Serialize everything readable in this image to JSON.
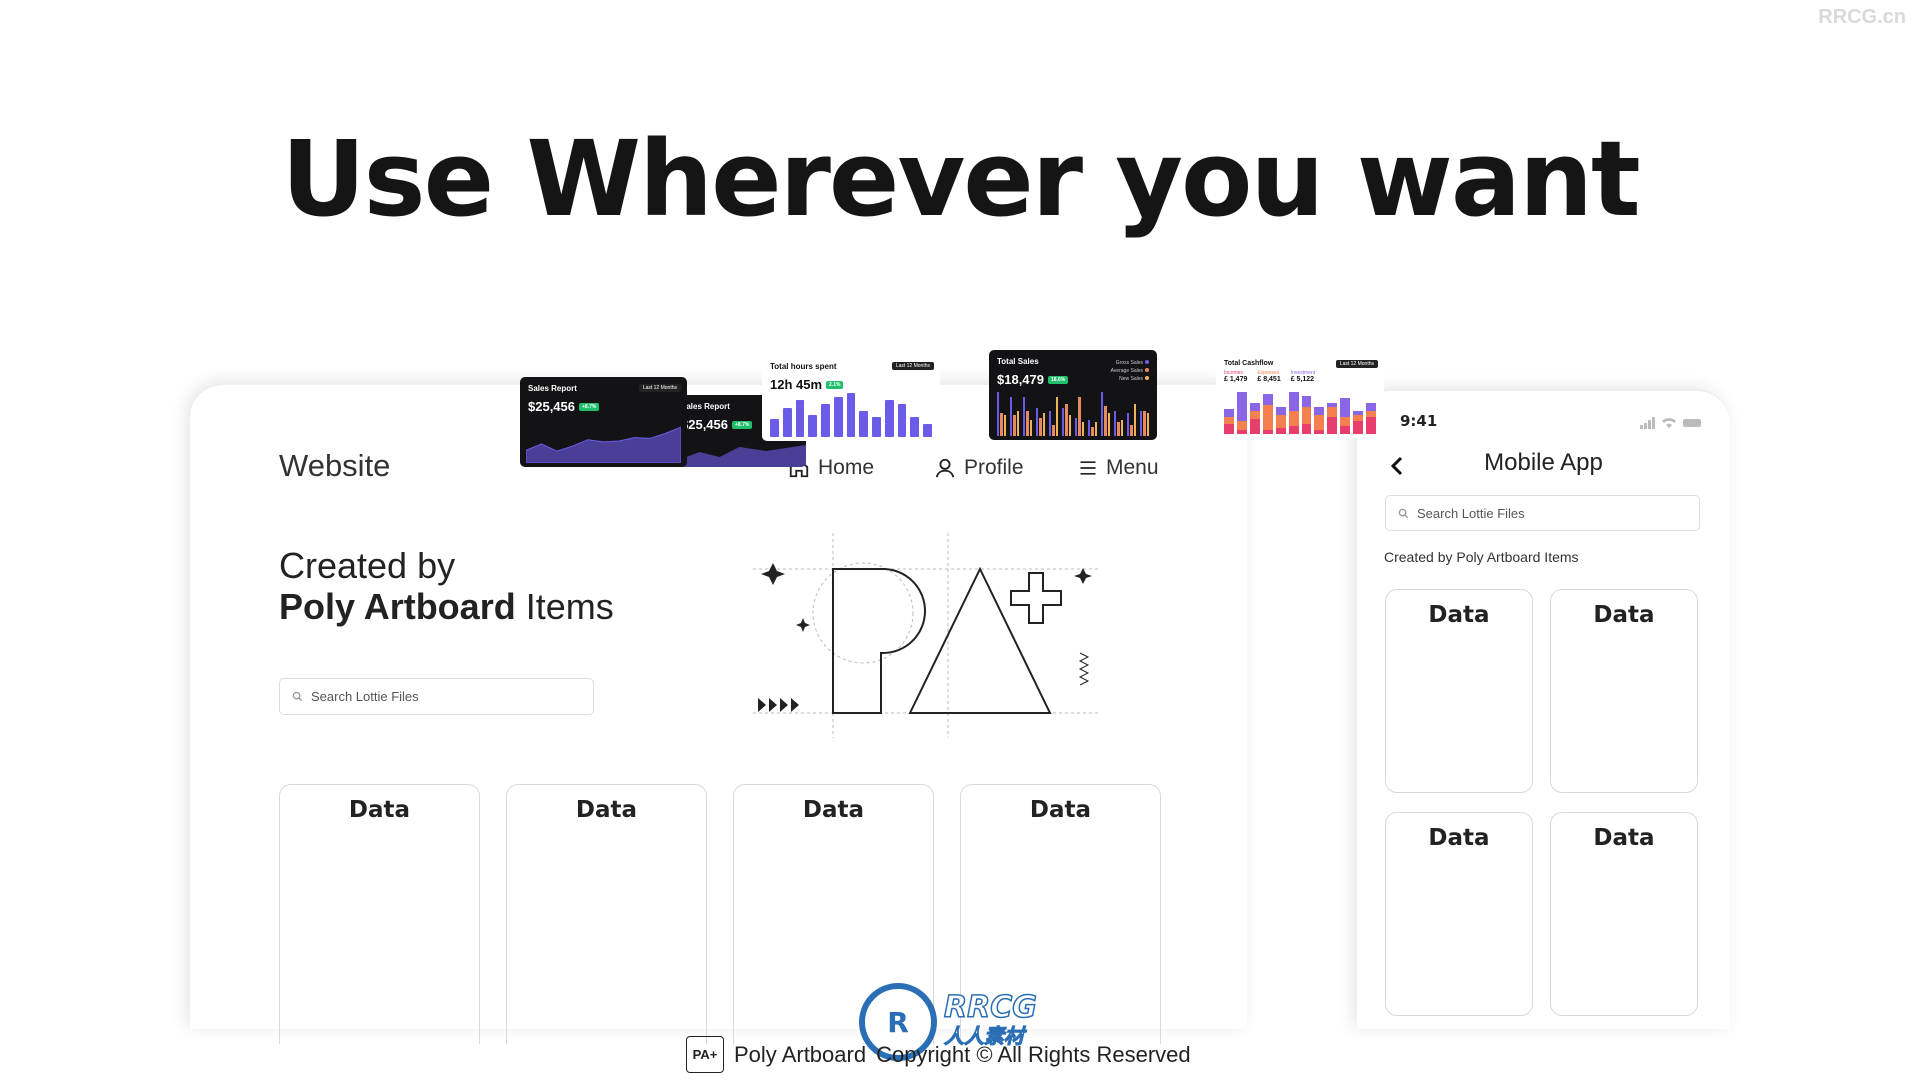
{
  "headline": "Use Wherever you want",
  "watermark_top": "RRCG.cn",
  "watermark_center": {
    "logo": "RRCG",
    "sub": "人人素材"
  },
  "website": {
    "title": "Website",
    "nav": [
      {
        "label": "Home",
        "icon": "home-icon"
      },
      {
        "label": "Profile",
        "icon": "user-icon"
      },
      {
        "label": "Menu",
        "icon": "menu-icon"
      }
    ],
    "hero_line1": "Created by",
    "hero_bold": "Poly Artboard",
    "hero_rest": " Items",
    "search_placeholder": "Search Lottie Files",
    "cards": [
      "Data",
      "Data",
      "Data",
      "Data"
    ]
  },
  "mobile": {
    "time": "9:41",
    "title": "Mobile App",
    "search_placeholder": "Search Lottie Files",
    "subtitle": "Created by Poly Artboard Items",
    "cards": [
      "Data",
      "Data",
      "Data",
      "Data"
    ]
  },
  "widgets": {
    "sales_report": {
      "title": "Sales Report",
      "value": "$25,456",
      "badge": "+8.7%",
      "period": "Last 12 Months",
      "series": [
        30,
        45,
        28,
        40,
        55,
        50,
        52,
        60,
        58,
        70,
        85
      ]
    },
    "sales_report_back": {
      "title": "Sales Report",
      "value": "$25,456",
      "badge": "+8.7%"
    },
    "hours": {
      "title": "Total hours spent",
      "value": "12h 45m",
      "badge": "2.1%",
      "period": "Last 12 Months",
      "values": [
        40,
        65,
        85,
        50,
        75,
        90,
        100,
        60,
        45,
        85,
        75,
        45,
        30
      ],
      "color": "#6b5ce7"
    },
    "total_sales": {
      "title": "Total Sales",
      "value": "$18,479",
      "badge": "18.6%",
      "legend": [
        {
          "label": "Gross Sales",
          "color": "#6b5ce7"
        },
        {
          "label": "Average Sales",
          "color": "#e98a5d"
        },
        {
          "label": "New Sales",
          "color": "#f0b35a"
        }
      ],
      "series": [
        [
          95,
          85,
          85,
          60,
          55,
          60,
          40,
          35,
          95,
          55,
          50,
          55
        ],
        [
          50,
          45,
          55,
          40,
          25,
          70,
          85,
          20,
          65,
          30,
          25,
          55
        ],
        [
          45,
          55,
          35,
          50,
          85,
          45,
          30,
          30,
          50,
          35,
          70,
          50
        ]
      ]
    },
    "cashflow": {
      "title": "Total Cashflow",
      "period": "Last 12 Months",
      "legend": [
        {
          "label": "Incomes",
          "value": "£ 1,479",
          "color": "#e83e6c"
        },
        {
          "label": "Expenses",
          "value": "£ 8,451",
          "color": "#f5804f"
        },
        {
          "label": "Investment",
          "value": "£ 5,122",
          "color": "#8a66e6"
        }
      ],
      "stack": [
        [
          25,
          10,
          35,
          10,
          15,
          20,
          25,
          10,
          40,
          20,
          30,
          40
        ],
        [
          15,
          20,
          20,
          60,
          30,
          40,
          40,
          35,
          25,
          20,
          15,
          15
        ],
        [
          20,
          70,
          20,
          25,
          20,
          50,
          25,
          20,
          10,
          45,
          10,
          20
        ]
      ]
    }
  },
  "footer": {
    "brand": "Poly Artboard",
    "copyright": "Copyright © All Rights Reserved",
    "logo": "PA+"
  }
}
